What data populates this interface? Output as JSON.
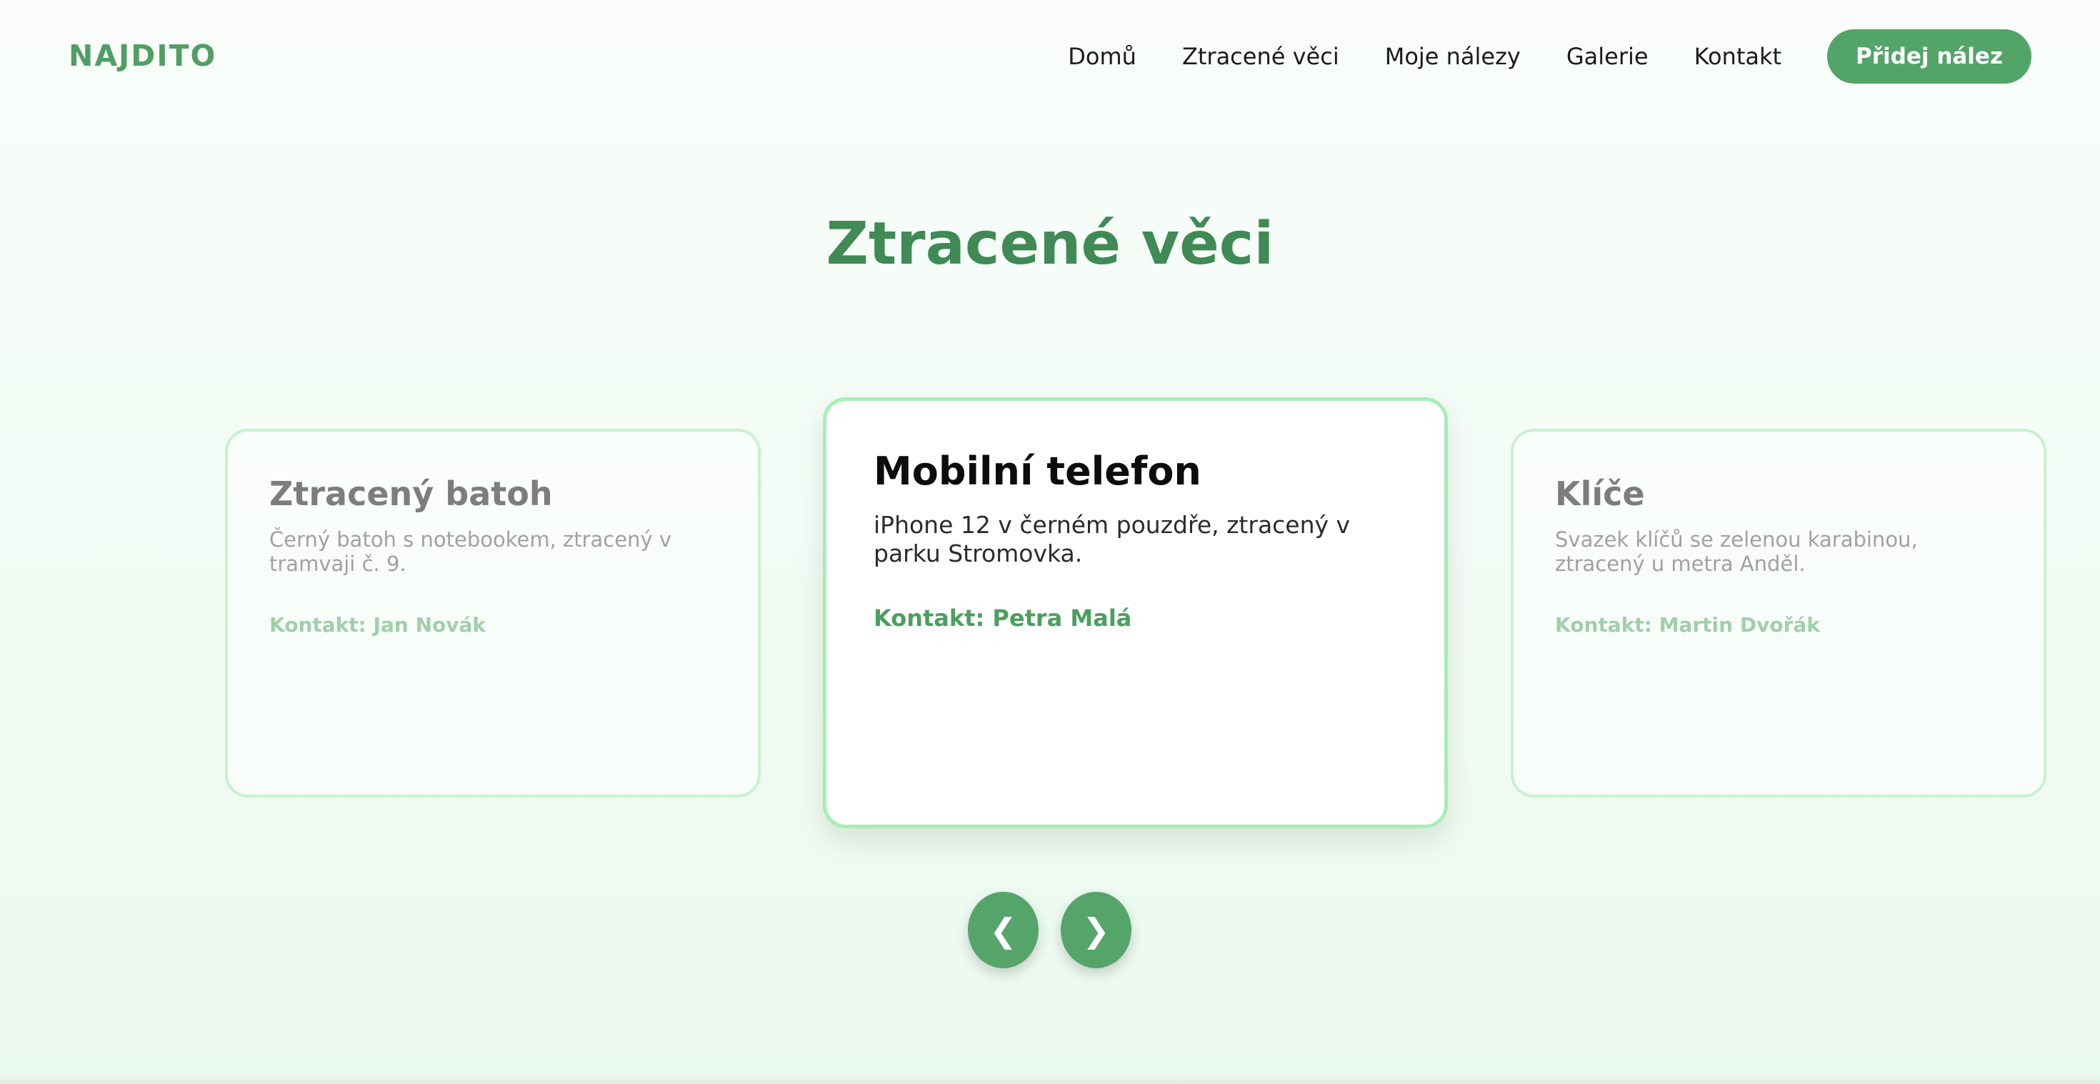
{
  "header": {
    "logo": "NAJDITO",
    "nav": [
      {
        "label": "Domů"
      },
      {
        "label": "Ztracené věci"
      },
      {
        "label": "Moje nálezy"
      },
      {
        "label": "Galerie"
      },
      {
        "label": "Kontakt"
      }
    ],
    "cta_label": "Přidej nález"
  },
  "main": {
    "title": "Ztracené věci",
    "cards": [
      {
        "title": "Ztracený batoh",
        "description": "Černý batoh s notebookem, ztracený v tramvaji č. 9.",
        "contact": "Kontakt: Jan Novák"
      },
      {
        "title": "Mobilní telefon",
        "description": "iPhone 12 v černém pouzdře, ztracený v parku Stromovka.",
        "contact": "Kontakt: Petra Malá"
      },
      {
        "title": "Klíče",
        "description": "Svazek klíčů se zelenou karabinou, ztracený u metra Anděl.",
        "contact": "Kontakt: Martin Dvořák"
      }
    ],
    "carousel": {
      "prev_icon": "❮",
      "next_icon": "❯"
    }
  },
  "colors": {
    "brand": "#4f9f62",
    "title": "#3f8a55",
    "button": "#53a468",
    "card_border_active": "#a6efb3"
  },
  "icons": {
    "prev": "chevron-left-icon",
    "next": "chevron-right-icon"
  }
}
